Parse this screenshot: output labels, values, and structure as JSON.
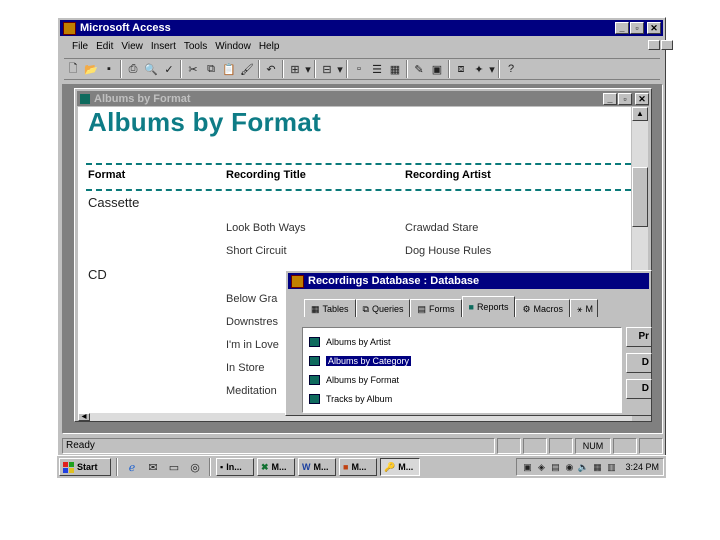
{
  "app": {
    "title": "Microsoft Access",
    "menu": [
      "File",
      "Edit",
      "View",
      "Insert",
      "Tools",
      "Window",
      "Help"
    ]
  },
  "report_window": {
    "title": "Albums by Format",
    "report_title": "Albums by Format",
    "columns": [
      "Format",
      "Recording Title",
      "Recording Artist"
    ],
    "groups": [
      {
        "format": "Cassette",
        "rows": [
          {
            "title": "Look Both Ways",
            "artist": "Crawdad Stare"
          },
          {
            "title": "Short Circuit",
            "artist": "Dog House Rules"
          }
        ]
      },
      {
        "format": "CD",
        "rows": [
          {
            "title": "Below Gra",
            "artist": ""
          },
          {
            "title": "Downstres",
            "artist": ""
          },
          {
            "title": "I'm in Love",
            "artist": ""
          },
          {
            "title": "In Store",
            "artist": ""
          },
          {
            "title": "Meditation",
            "artist": ""
          }
        ]
      }
    ]
  },
  "db_window": {
    "title": "Recordings Database : Database",
    "tabs": [
      "Tables",
      "Queries",
      "Forms",
      "Reports",
      "Macros",
      "M"
    ],
    "active_tab": "Reports",
    "reports": [
      "Albums by Artist",
      "Albums by Category",
      "Albums by Format",
      "Tracks by Album"
    ],
    "selected_report": "Albums by Category",
    "side_buttons": [
      "Pr",
      "D",
      "D"
    ]
  },
  "status_bar": {
    "text": "Ready",
    "indicator": "NUM"
  },
  "taskbar": {
    "start": "Start",
    "tasks": [
      "In...",
      "M...",
      "M...",
      "M...",
      "M..."
    ],
    "clock": "3:24 PM"
  }
}
